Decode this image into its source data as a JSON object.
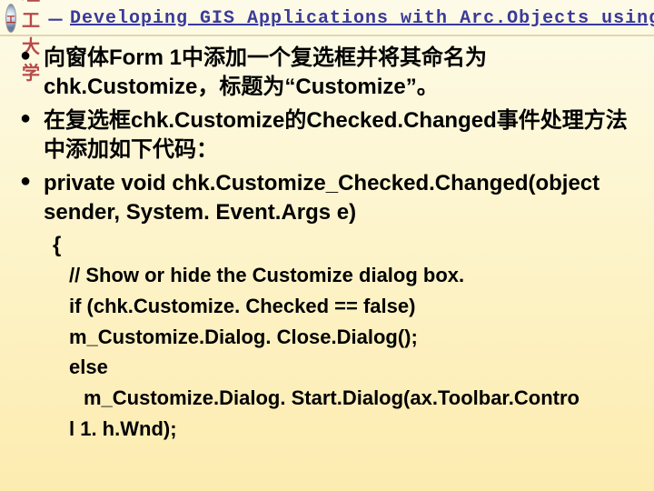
{
  "header": {
    "uni_cn": "西理工大学",
    "sep": "－",
    "title_en": "Developing GIS Applications with Arc.Objects using C#. NE"
  },
  "bullets": {
    "b1": "向窗体Form 1中添加一个复选框并将其命名为chk.Customize，标题为“Customize”。",
    "b2": "在复选框chk.Customize的Checked.Changed事件处理方法中添加如下代码：",
    "b3": "private void chk.Customize_Checked.Changed(object sender, System. Event.Args e)"
  },
  "code": {
    "open_brace": "{",
    "c1": "// Show or hide the Customize dialog box.",
    "c2": "if (chk.Customize. Checked == false)",
    "c3": "m_Customize.Dialog. Close.Dialog();",
    "c4": "else",
    "c5": "m_Customize.Dialog. Start.Dialog(ax.Toolbar.Contro",
    "c6": "l 1. h.Wnd);"
  }
}
